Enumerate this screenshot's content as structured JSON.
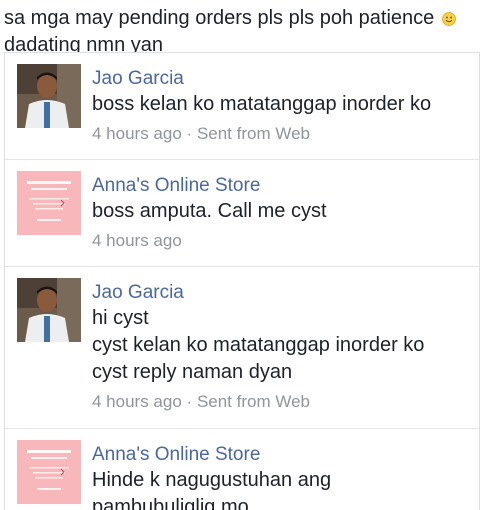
{
  "caption": {
    "line1": "sa mga may pending orders pls pls poh patience",
    "line2": "dadating nmn yan",
    "emoji": "smiley-emoji-icon"
  },
  "messages": [
    {
      "sender": "Jao Garcia",
      "avatar": "person-photo-avatar",
      "lines": [
        "boss kelan ko matatanggap inorder ko"
      ],
      "time": "4 hours ago",
      "separator": "·",
      "source": "Sent from Web"
    },
    {
      "sender": "Anna's Online Store",
      "avatar": "store-logo-avatar",
      "lines": [
        "boss amputa. Call me cyst"
      ],
      "time": "4 hours ago"
    },
    {
      "sender": "Jao Garcia",
      "avatar": "person-photo-avatar",
      "lines": [
        "hi cyst",
        "cyst kelan ko matatanggap inorder ko",
        "cyst reply naman dyan"
      ],
      "time": "4 hours ago",
      "separator": "·",
      "source": "Sent from Web"
    },
    {
      "sender": "Anna's Online Store",
      "avatar": "store-logo-avatar",
      "lines": [
        "Hinde k nagugustuhan ang",
        "pambubuliglig mo"
      ]
    }
  ],
  "colors": {
    "sender_name": "#4b67a1",
    "meta_text": "#90949c",
    "store_logo_bg": "#f8b8bb"
  }
}
